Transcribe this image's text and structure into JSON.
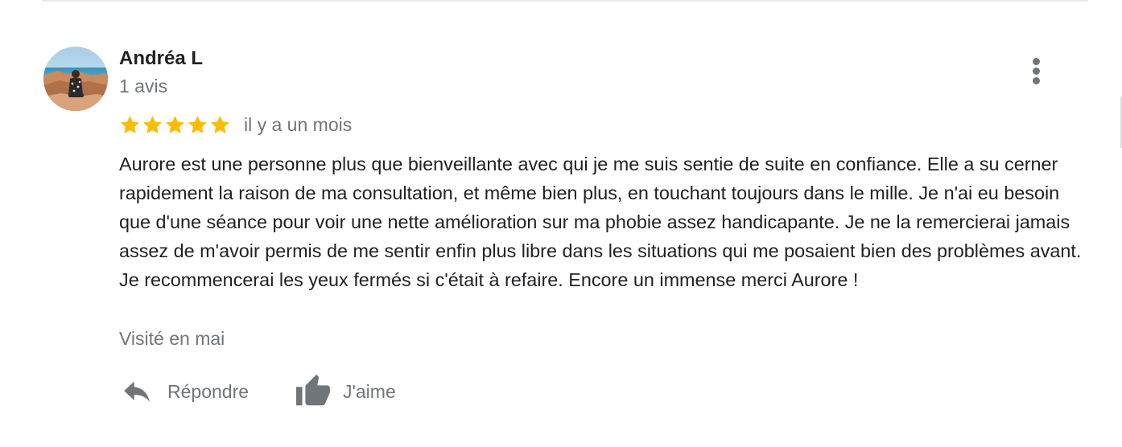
{
  "review": {
    "reviewer": {
      "name": "Andréa L",
      "meta": "1 avis",
      "avatar": "profile-photo-beach"
    },
    "rating": {
      "stars": 5,
      "max": 5,
      "star_color": "#fbbc04"
    },
    "date": "il y a un mois",
    "text": "Aurore est une personne plus que bienveillante avec qui je me suis sentie de suite en confiance. Elle a su cerner rapidement la raison de ma consultation, et même bien plus, en touchant toujours dans le mille. Je n'ai eu besoin que d'une séance pour voir une nette amélioration sur ma phobie assez handicapante. Je ne la remercierai jamais assez de m'avoir permis de me sentir enfin plus libre dans les situations qui me posaient bien des problèmes avant. Je recommencerai les yeux fermés si c'était à refaire. Encore un immense merci Aurore !",
    "visited": "Visité en mai"
  },
  "actions": {
    "reply_label": "Répondre",
    "reply_icon": "reply-arrow-icon",
    "like_label": "J'aime",
    "like_icon": "thumbs-up-icon"
  },
  "menu": {
    "icon": "more-vertical-icon"
  },
  "colors": {
    "text_primary": "#202124",
    "text_secondary": "#70757a",
    "star": "#fbbc04",
    "divider": "#e8eaed"
  }
}
